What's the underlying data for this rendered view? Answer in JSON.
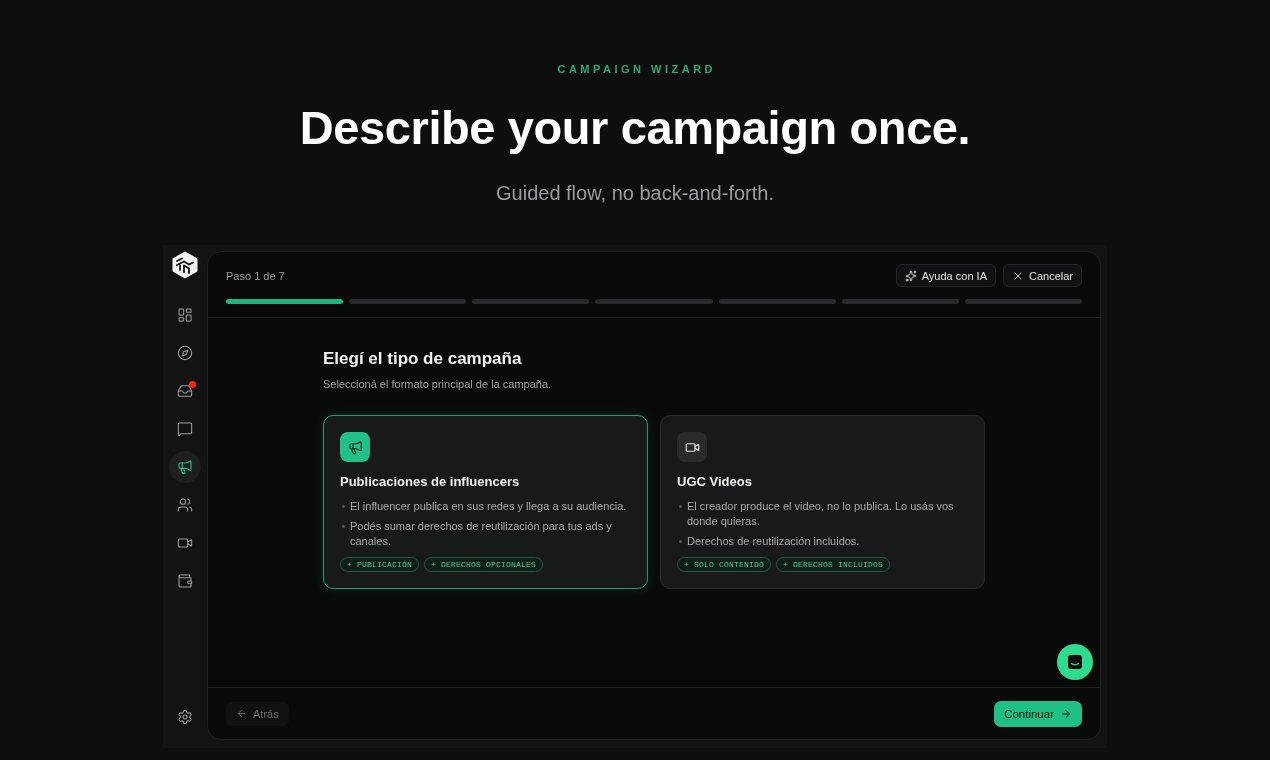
{
  "hero": {
    "eyebrow": "CAMPAIGN WIZARD",
    "title": "Describe your campaign once.",
    "subtitle": "Guided flow, no back-and-forth."
  },
  "sidebar": {
    "items": [
      {
        "selected": false,
        "unread": false
      },
      {
        "selected": false,
        "unread": false
      },
      {
        "selected": false,
        "unread": true
      },
      {
        "selected": false,
        "unread": false
      },
      {
        "selected": true,
        "unread": false
      },
      {
        "selected": false,
        "unread": false
      },
      {
        "selected": false,
        "unread": false
      },
      {
        "selected": false,
        "unread": false
      }
    ]
  },
  "wizard": {
    "step_label": "Paso 1 de 7",
    "ai_help_button": {
      "label": "Ayuda con IA"
    },
    "cancel_button": {
      "label": "Cancelar"
    },
    "progress": [
      {
        "done": true
      },
      {
        "done": false
      },
      {
        "done": false
      },
      {
        "done": false
      },
      {
        "done": false
      },
      {
        "done": false
      },
      {
        "done": false
      }
    ],
    "title": "Elegí el tipo de campaña",
    "subtitle": "Seleccioná el formato principal de la campaña.",
    "cards": [
      {
        "selected": true,
        "title": "Publicaciones de influencers",
        "bullets": [
          "El influencer publica en sus redes y llega a su audiencia.",
          "Podés sumar derechos de reutilización para tus ads y canales."
        ],
        "tags": [
          "+ PUBLICACIÓN",
          "+ DERECHOS OPCIONALES"
        ]
      },
      {
        "selected": false,
        "title": "UGC Videos",
        "bullets": [
          "El creador produce el video, no lo publica. Lo usás vos donde quieras.",
          "Derechos de reutilización incluidos."
        ],
        "tags": [
          "+ SOLO CONTENIDO",
          "+ DERECHOS INCLUIDOS"
        ]
      }
    ],
    "back_button": {
      "label": "Atrás",
      "disabled": true
    },
    "continue_button": {
      "label": "Continuar"
    }
  }
}
